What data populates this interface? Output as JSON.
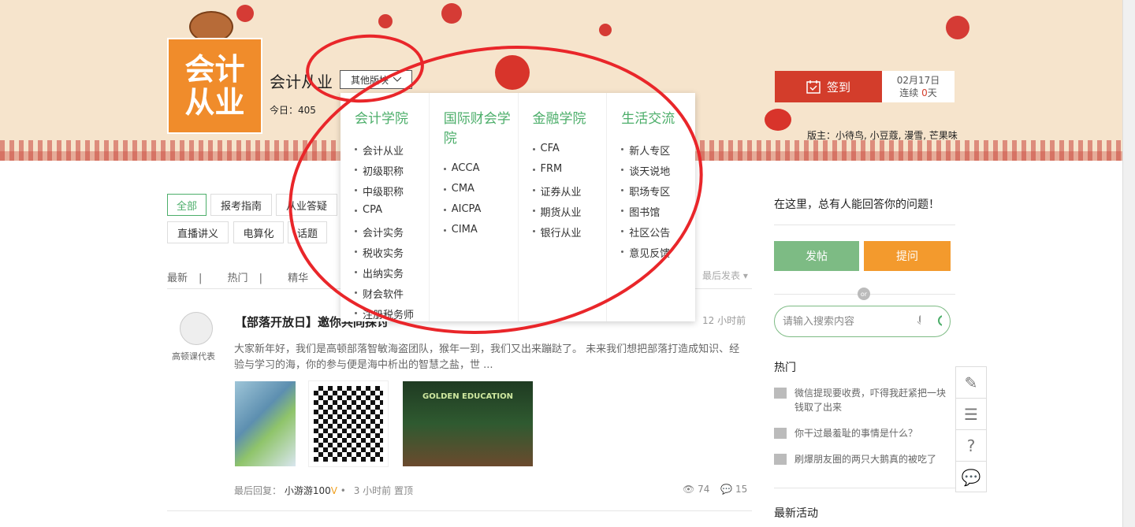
{
  "banner": {
    "logo_line1": "会计",
    "logo_line2": "从业",
    "forum_title": "会计从业",
    "switcher_label": "其他版块",
    "today": "今日：405",
    "checkin_label": "签到",
    "checkin_date": "02月17日",
    "streak_prefix": "连续",
    "streak_days": "0",
    "streak_suffix": "天",
    "moderators": "版主：小待鸟, 小豆蔻, 漫雪, 芒果味"
  },
  "dropdown": {
    "columns": [
      {
        "title": "会计学院",
        "items": [
          "会计从业",
          "初级职称",
          "中级职称",
          "CPA",
          "会计实务",
          "税收实务",
          "出纳实务",
          "财会软件",
          "注册税务师"
        ]
      },
      {
        "title": "国际财会学院",
        "items": [
          "ACCA",
          "CMA",
          "AICPA",
          "CIMA"
        ]
      },
      {
        "title": "金融学院",
        "items": [
          "CFA",
          "FRM",
          "证券从业",
          "期货从业",
          "银行从业"
        ]
      },
      {
        "title": "生活交流",
        "items": [
          "新人专区",
          "谈天说地",
          "职场专区",
          "图书馆",
          "社区公告",
          "意见反馈"
        ]
      }
    ]
  },
  "filters": {
    "tags": [
      "全部",
      "报考指南",
      "从业答疑",
      "直播讲义",
      "电算化",
      "话题"
    ],
    "sort": [
      "最新",
      "热门",
      "精华"
    ],
    "sort_sep": "|",
    "sort_right": "最后发表"
  },
  "post": {
    "author": "高顿课代表",
    "title": "【部落开放日】邀你共同探讨",
    "time": "12 小时前",
    "excerpt": "大家新年好，我们是高顿部落智敏海盗团队，猴年一到，我们又出来蹦跶了。 未来我们想把部落打造成知识、经验与学习的海，你的参与便是海中析出的智慧之盐，世 ...",
    "last_reply_label": "最后回复：",
    "last_reply_user": "小游游100",
    "meta_time": "3 小时前",
    "meta_tag": "置顶",
    "views": "74",
    "comments": "15",
    "image_caption": "GOLDEN EDUCATION"
  },
  "sidebar": {
    "tip": "在这里，总有人能回答你的问题！",
    "post_button": "发帖",
    "ask_button": "提问",
    "or_label": "or",
    "search_placeholder": "请输入搜索内容",
    "hot_title": "热门",
    "hot_items": [
      "微信提现要收费，吓得我赶紧把一块钱取了出来",
      "你干过最羞耻的事情是什么？",
      "刷爆朋友圈的两只大鹅真的被吃了"
    ],
    "latest_title": "最新活动"
  },
  "colors": {
    "accent_green": "#4cae6a",
    "checkin_red": "#d33d2b",
    "ask_orange": "#f39a2d",
    "annotation_red": "#e9262a"
  }
}
